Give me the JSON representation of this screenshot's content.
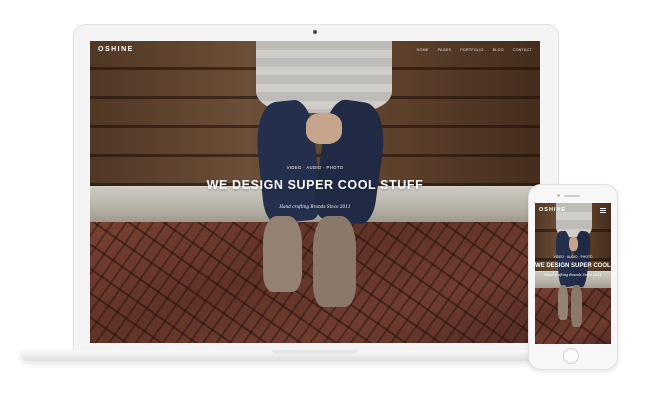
{
  "brand": {
    "logo": "OSHINE"
  },
  "nav": {
    "items": [
      "HOME",
      "PAGES",
      "PORTFOLIO",
      "BLOG",
      "CONTACT"
    ]
  },
  "hero": {
    "subtitle": "VIDEO · AUDIO · PHOTO",
    "headline": "WE DESIGN SUPER COOL STUFF",
    "tagline": "Hand crafting Brands Since 2011"
  },
  "icons": {
    "mobile_menu": "hamburger-menu-icon"
  }
}
